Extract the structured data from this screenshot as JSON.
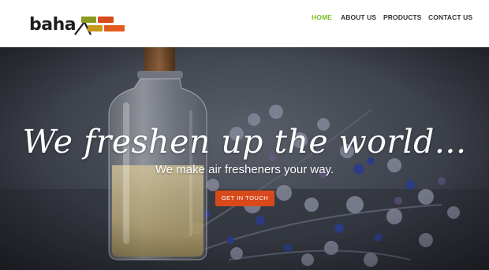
{
  "logo": {
    "text": "baha",
    "brick_colors": [
      "#8a9a1e",
      "#d84a1b",
      "#e35c1f",
      "#c8981a"
    ]
  },
  "nav": {
    "items": [
      {
        "label": "HOME",
        "active": true
      },
      {
        "label": "ABOUT US",
        "active": false
      },
      {
        "label": "PRODUCTS",
        "active": false
      },
      {
        "label": "CONTACT US",
        "active": false
      }
    ],
    "active_color": "#7dbb2e"
  },
  "hero": {
    "headline": "We freshen up the world...",
    "subline": "We make air fresheners your way.",
    "cta_label": "GET IN TOUCH",
    "cta_color": "#d84a1b"
  }
}
